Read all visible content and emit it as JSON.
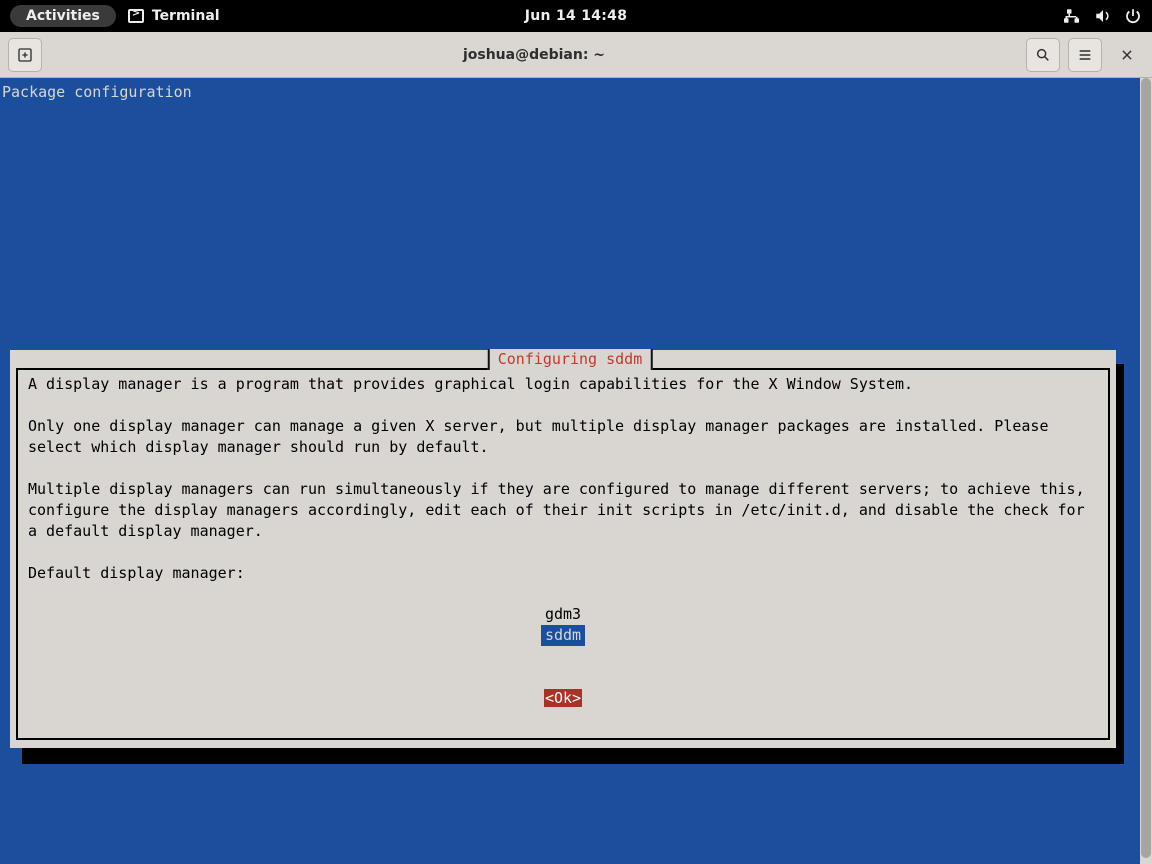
{
  "topbar": {
    "activities": "Activities",
    "app_name": "Terminal",
    "clock": "Jun 14  14:48"
  },
  "headerbar": {
    "title": "joshua@debian: ~"
  },
  "term": {
    "header": "Package configuration",
    "dialog_title": "Configuring sddm",
    "para1": "A display manager is a program that provides graphical login capabilities for the X Window System.",
    "para2": "Only one display manager can manage a given X server, but multiple display manager packages are installed. Please select which display manager should run by default.",
    "para3": "Multiple display managers can run simultaneously if they are configured to manage different servers; to achieve this, configure the display managers accordingly, edit each of their init scripts in /etc/init.d, and disable the check for a default display manager.",
    "prompt": "Default display manager:",
    "options": [
      "gdm3",
      "sddm"
    ],
    "selected_index": 1,
    "ok_label": "<Ok>"
  }
}
